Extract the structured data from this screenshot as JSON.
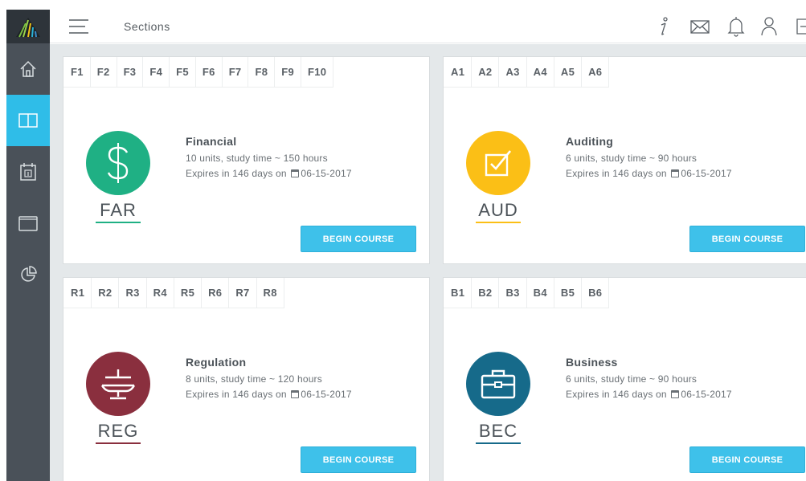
{
  "topbar": {
    "title": "Sections"
  },
  "colors": {
    "accent": "#2fbde8",
    "button": "#3ec1ea",
    "sidebar": "#4a5159"
  },
  "cards": [
    {
      "tabs": [
        "F1",
        "F2",
        "F3",
        "F4",
        "F5",
        "F6",
        "F7",
        "F8",
        "F9",
        "F10"
      ],
      "name": "Financial",
      "units": "10 units, study time ~ 150 hours",
      "expires": "Expires in 146 days on",
      "date": "06-15-2017",
      "code": "FAR",
      "icon": "dollar-icon",
      "color": "#1fb084",
      "button": "BEGIN COURSE"
    },
    {
      "tabs": [
        "A1",
        "A2",
        "A3",
        "A4",
        "A5",
        "A6"
      ],
      "name": "Auditing",
      "units": "6 units, study time ~ 90 hours",
      "expires": "Expires in 146 days on",
      "date": "06-15-2017",
      "code": "AUD",
      "icon": "checkbox-icon",
      "color": "#fbbf16",
      "button": "BEGIN COURSE"
    },
    {
      "tabs": [
        "R1",
        "R2",
        "R3",
        "R4",
        "R5",
        "R6",
        "R7",
        "R8"
      ],
      "name": "Regulation",
      "units": "8 units, study time ~ 120 hours",
      "expires": "Expires in 146 days on",
      "date": "06-15-2017",
      "code": "REG",
      "icon": "scales-icon",
      "color": "#8a2f3e",
      "button": "BEGIN COURSE"
    },
    {
      "tabs": [
        "B1",
        "B2",
        "B3",
        "B4",
        "B5",
        "B6"
      ],
      "name": "Business",
      "units": "6 units, study time ~ 90 hours",
      "expires": "Expires in 146 days on",
      "date": "06-15-2017",
      "code": "BEC",
      "icon": "briefcase-icon",
      "color": "#166a8a",
      "button": "BEGIN COURSE"
    }
  ]
}
